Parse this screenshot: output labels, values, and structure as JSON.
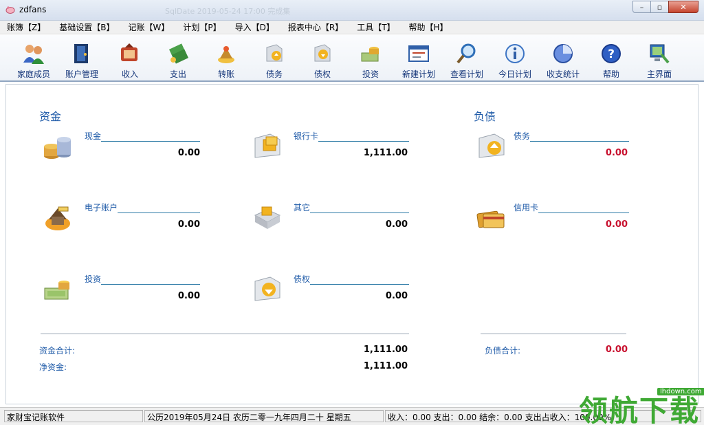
{
  "window": {
    "title": "zdfans",
    "ghost_title": "SqlDate    2019-05-24 17:00    完成集",
    "minimize": "–",
    "maximize": "▫",
    "close": "✕"
  },
  "menu": [
    "账簿【Z】",
    "基础设置【B】",
    "记账【W】",
    "计划【P】",
    "导入【D】",
    "报表中心【R】",
    "工具【T】",
    "帮助【H】"
  ],
  "toolbar": [
    {
      "label": "家庭成员",
      "icon": "family-members-icon"
    },
    {
      "label": "账户管理",
      "icon": "account-management-icon"
    },
    {
      "label": "收入",
      "icon": "income-icon"
    },
    {
      "label": "支出",
      "icon": "expense-icon"
    },
    {
      "label": "转账",
      "icon": "transfer-icon"
    },
    {
      "label": "债务",
      "icon": "debt-icon"
    },
    {
      "label": "债权",
      "icon": "creditor-rights-icon"
    },
    {
      "label": "投资",
      "icon": "investment-icon"
    },
    {
      "label": "新建计划",
      "icon": "new-plan-icon"
    },
    {
      "label": "查看计划",
      "icon": "view-plan-icon"
    },
    {
      "label": "今日计划",
      "icon": "today-plan-icon"
    },
    {
      "label": "收支统计",
      "icon": "statistics-icon"
    },
    {
      "label": "帮助",
      "icon": "help-icon"
    },
    {
      "label": "主界面",
      "icon": "main-interface-icon"
    }
  ],
  "assets": {
    "title": "资金",
    "items": [
      {
        "label": "现金",
        "value": "0.00",
        "icon": "cash-coins-icon"
      },
      {
        "label": "银行卡",
        "value": "1,111.00",
        "icon": "bank-card-icon"
      },
      {
        "label": "电子账户",
        "value": "0.00",
        "icon": "e-account-icon"
      },
      {
        "label": "其它",
        "value": "0.00",
        "icon": "other-icon"
      },
      {
        "label": "投资",
        "value": "0.00",
        "icon": "investment-money-icon"
      },
      {
        "label": "债权",
        "value": "0.00",
        "icon": "creditor-folder-icon"
      }
    ],
    "total_label": "资金合计:",
    "total_value": "1,111.00",
    "net_label": "净资金:",
    "net_value": "1,111.00"
  },
  "liabilities": {
    "title": "负债",
    "items": [
      {
        "label": "债务",
        "value": "0.00",
        "icon": "debt-folder-icon"
      },
      {
        "label": "信用卡",
        "value": "0.00",
        "icon": "credit-card-icon"
      }
    ],
    "total_label": "负债合计:",
    "total_value": "0.00"
  },
  "status": {
    "app": "家财宝记账软件",
    "date": "公历2019年05月24日  农历二零一九年四月二十   星期五",
    "summary": "收入：0.00 支出：0.00 结余：0.00 支出占收入：100.00%"
  },
  "watermark": {
    "text": "领航下载",
    "url": "lhdown.com"
  },
  "colors": {
    "accent": "#1e5aa8",
    "negative": "#c8102e",
    "line": "#2c7aa6"
  }
}
